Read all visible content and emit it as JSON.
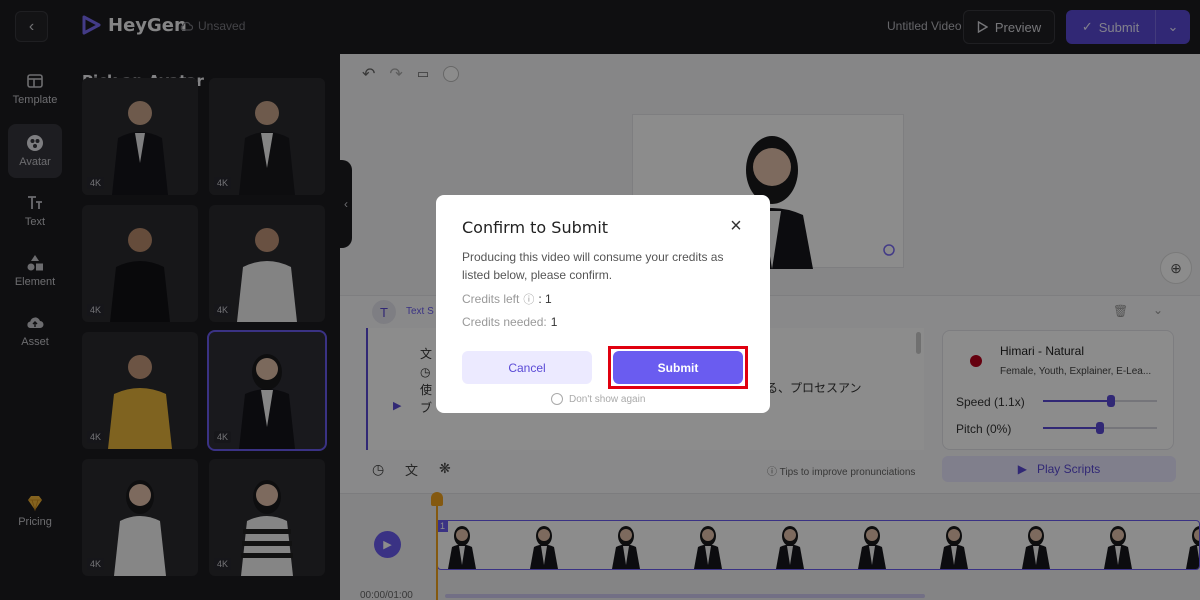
{
  "topbar": {
    "app_name": "HeyGen",
    "unsaved": "Unsaved",
    "video_title": "Untitled Video",
    "preview_label": "Preview",
    "submit_label": "Submit"
  },
  "rail": [
    {
      "label": "Template",
      "icon": "template-icon"
    },
    {
      "label": "Avatar",
      "icon": "avatar-icon",
      "active": true
    },
    {
      "label": "Text",
      "icon": "text-icon"
    },
    {
      "label": "Element",
      "icon": "element-icon"
    },
    {
      "label": "Asset",
      "icon": "asset-icon"
    },
    {
      "label": "Pricing",
      "icon": "diamond-icon"
    }
  ],
  "panel": {
    "title": "Pick an Avatar",
    "badge": "4K"
  },
  "editor": {
    "section_label": "Text S",
    "script_lines": [
      "文",
      "使",
      "ブ"
    ],
    "script_fragment": "にある、プロセスアン",
    "tips": "Tips to improve pronunciations",
    "play_scripts": "Play Scripts",
    "voice_name": "Himari - Natural",
    "voice_tags": "Female, Youth, Explainer, E-Lea...",
    "speed_label": "Speed (1.1x)",
    "pitch_label": "Pitch (0%)",
    "speed_fraction": 0.6,
    "pitch_fraction": 0.5
  },
  "timeline": {
    "scene_number": "1",
    "time": "00:00/01:00"
  },
  "modal": {
    "title": "Confirm to Submit",
    "description": "Producing this video will consume your credits as listed below, please confirm.",
    "credits_left_label": "Credits left",
    "credits_left_value": ": 1",
    "credits_needed_label": "Credits needed:",
    "credits_needed_value": "1",
    "cancel_label": "Cancel",
    "submit_label": "Submit",
    "dont_show": "Don't show again"
  },
  "colors": {
    "accent": "#6a5cf0",
    "dark_bg": "#1c1c1f",
    "highlight": "#e0000f"
  }
}
